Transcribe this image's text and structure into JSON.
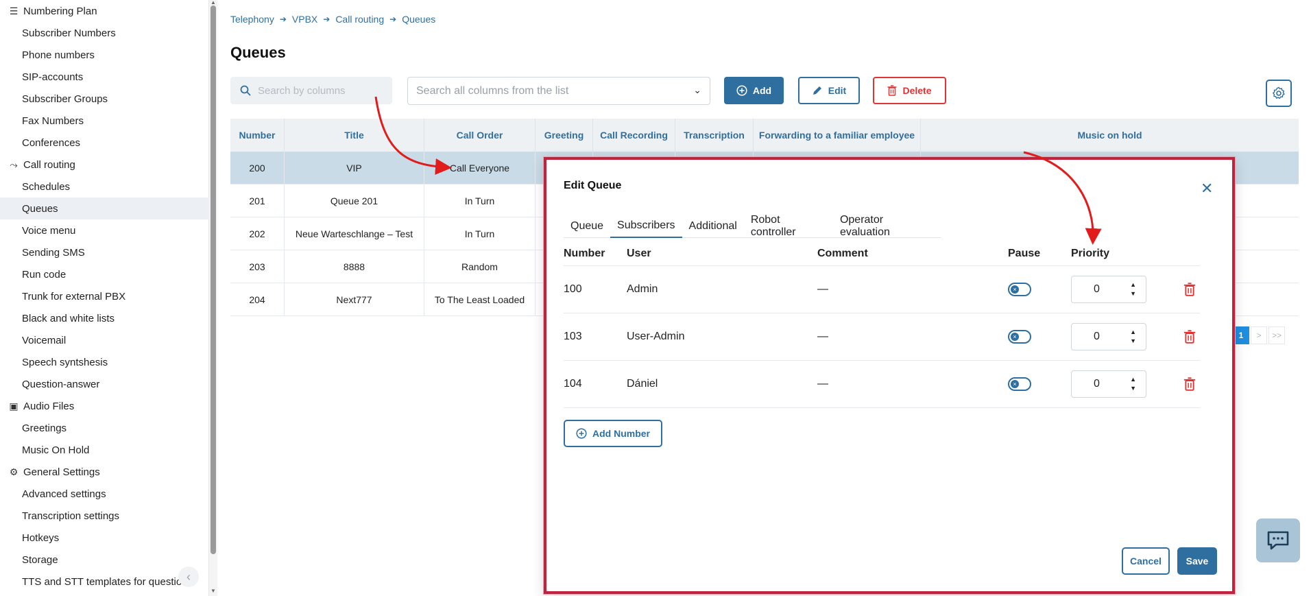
{
  "sidebar": {
    "items": [
      {
        "label": "Numbering Plan",
        "type": "section",
        "icon": "list-icon"
      },
      {
        "label": "Subscriber Numbers"
      },
      {
        "label": "Phone numbers"
      },
      {
        "label": "SIP-accounts"
      },
      {
        "label": "Subscriber Groups"
      },
      {
        "label": "Fax Numbers"
      },
      {
        "label": "Conferences"
      },
      {
        "label": "Call routing",
        "type": "section",
        "icon": "routing-icon"
      },
      {
        "label": "Schedules"
      },
      {
        "label": "Queues",
        "active": true
      },
      {
        "label": "Voice menu"
      },
      {
        "label": "Sending SMS"
      },
      {
        "label": "Run code"
      },
      {
        "label": "Trunk for external PBX"
      },
      {
        "label": "Black and white lists"
      },
      {
        "label": "Voicemail"
      },
      {
        "label": "Speech syntshesis"
      },
      {
        "label": "Question-answer"
      },
      {
        "label": "Audio Files",
        "type": "section",
        "icon": "audio-files-icon"
      },
      {
        "label": "Greetings"
      },
      {
        "label": "Music On Hold"
      },
      {
        "label": "General Settings",
        "type": "section",
        "icon": "gear-icon"
      },
      {
        "label": "Advanced settings"
      },
      {
        "label": "Transcription settings"
      },
      {
        "label": "Hotkeys"
      },
      {
        "label": "Storage"
      },
      {
        "label": "TTS and STT templates for question-"
      }
    ]
  },
  "breadcrumb": [
    "Telephony",
    "VPBX",
    "Call routing",
    "Queues"
  ],
  "page_title": "Queues",
  "search": {
    "placeholder": "Search by columns"
  },
  "column_select": {
    "placeholder": "Search all columns from the list"
  },
  "toolbar": {
    "add_label": "Add",
    "edit_label": "Edit",
    "delete_label": "Delete"
  },
  "table": {
    "headers": [
      "Number",
      "Title",
      "Call Order",
      "Greeting",
      "Call Recording",
      "Transcription",
      "Forwarding to a familiar employee",
      "Music on hold"
    ],
    "rows": [
      {
        "number": "200",
        "title": "VIP",
        "order": "Call Everyone",
        "selected": true
      },
      {
        "number": "201",
        "title": "Queue 201",
        "order": "In Turn"
      },
      {
        "number": "202",
        "title": "Neue Warteschlange – Test",
        "order": "In Turn"
      },
      {
        "number": "203",
        "title": "8888",
        "order": "Random"
      },
      {
        "number": "204",
        "title": "Next777",
        "order": "To The Least Loaded"
      }
    ]
  },
  "pagination": {
    "current": "1",
    "next": ">",
    "last": ">>"
  },
  "dialog": {
    "title": "Edit Queue",
    "tabs": [
      "Queue",
      "Subscribers",
      "Additional",
      "Robot controller",
      "Operator evaluation"
    ],
    "active_tab": "Subscribers",
    "columns": [
      "Number",
      "User",
      "Comment",
      "Pause",
      "Priority"
    ],
    "rows": [
      {
        "number": "100",
        "user": "Admin",
        "comment": "—",
        "priority": "0"
      },
      {
        "number": "103",
        "user": "User-Admin",
        "comment": "—",
        "priority": "0"
      },
      {
        "number": "104",
        "user": "Dániel",
        "comment": "—",
        "priority": "0"
      }
    ],
    "add_number_label": "Add Number",
    "cancel_label": "Cancel",
    "save_label": "Save"
  },
  "colors": {
    "accent": "#2f6fa0",
    "danger": "#e03333",
    "highlight_border": "#c0233d",
    "arrow": "#e21b1b"
  }
}
